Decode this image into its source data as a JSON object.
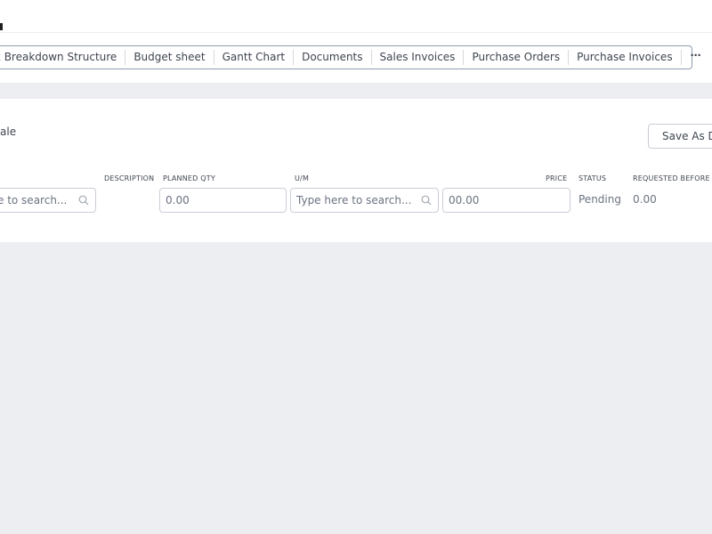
{
  "tabs": [
    "rk Breakdown Structure",
    "Budget sheet",
    "Gantt Chart",
    "Documents",
    "Sales Invoices",
    "Purchase Orders",
    "Purchase Invoices"
  ],
  "more_label": "⋯",
  "section": {
    "title": "ale",
    "save_draft_label": "Save As D"
  },
  "columns": {
    "description": "DESCRIPTION",
    "planned_qty": "PLANNED QTY",
    "um": "U/M",
    "price": "PRICE",
    "status": "STATUS",
    "requested_before": "REQUESTED BEFORE"
  },
  "row": {
    "item_search_placeholder": "e to search...",
    "planned_qty_value": "0.00",
    "um_search_placeholder": "Type here to search...",
    "price_value": "00.00",
    "status": "Pending",
    "requested_before": "0.00"
  }
}
